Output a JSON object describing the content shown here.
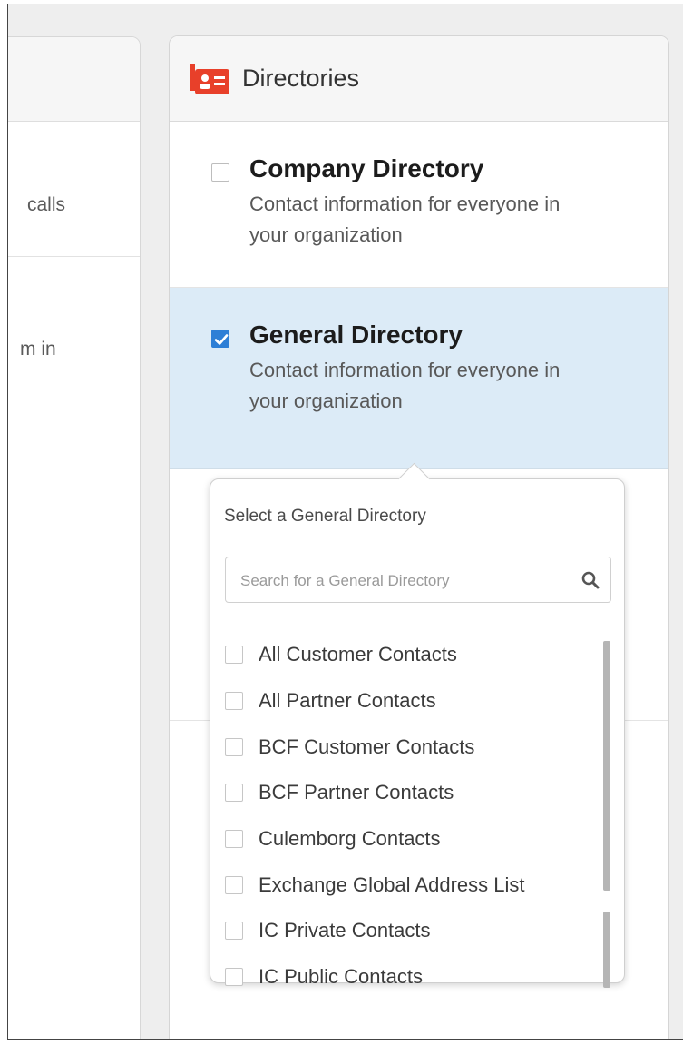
{
  "left_panel": {
    "row1_fragment": "calls",
    "row2_fragment": "m in"
  },
  "directories": {
    "title": "Directories",
    "icon": "contact-card-icon",
    "accent_color": "#e8402a",
    "options": [
      {
        "title": "Company Directory",
        "description_line1": "Contact information for everyone in",
        "description_line2": "your organization",
        "checked": false
      },
      {
        "title": "General Directory",
        "description_line1": "Contact information for everyone in",
        "description_line2": "your organization",
        "checked": true
      }
    ]
  },
  "general_picker": {
    "label": "Select a General Directory",
    "search_placeholder": "Search for a General Directory",
    "items": [
      "All Customer Contacts",
      "All Partner Contacts",
      "BCF Customer Contacts",
      "BCF Partner Contacts",
      "Culemborg Contacts",
      "Exchange Global Address List",
      "IC Private Contacts",
      "IC Public Contacts"
    ]
  }
}
